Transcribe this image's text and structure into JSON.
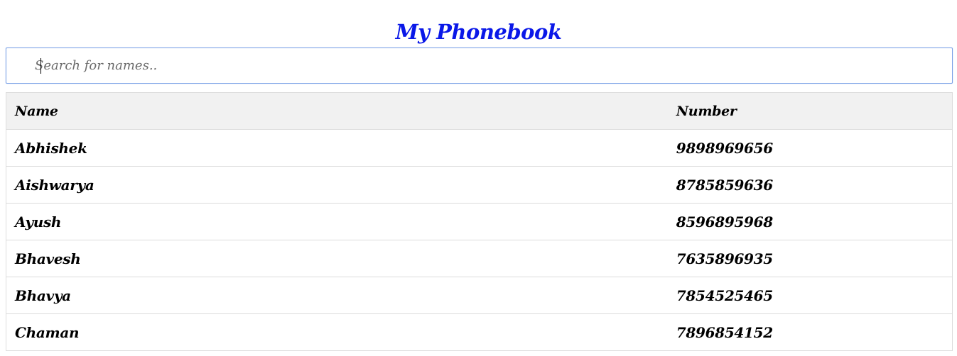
{
  "header": {
    "title": "My Phonebook"
  },
  "search": {
    "placeholder": "Search for names..",
    "value": ""
  },
  "table": {
    "columns": [
      "Name",
      "Number"
    ],
    "rows": [
      {
        "name": "Abhishek",
        "number": "9898969656"
      },
      {
        "name": "Aishwarya",
        "number": "8785859636"
      },
      {
        "name": "Ayush",
        "number": "8596895968"
      },
      {
        "name": "Bhavesh",
        "number": "7635896935"
      },
      {
        "name": "Bhavya",
        "number": "7854525465"
      },
      {
        "name": "Chaman",
        "number": "7896854152"
      }
    ]
  },
  "colors": {
    "title": "#0a18e8",
    "header_bg": "#f1f1f1",
    "border": "#dcdcdc",
    "focus_border": "#7da3e6"
  }
}
